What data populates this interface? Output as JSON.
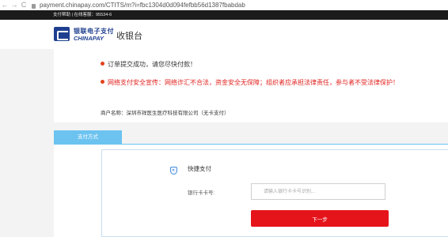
{
  "browser": {
    "url": "payment.chinapay.com/CTITS/m?i=fbc1304d0d094fefbb56d1387fbabdab",
    "back_icon": "←",
    "forward_icon": "→",
    "reload_icon": "C"
  },
  "topbar": {
    "text": "支付帮助 | 在线客服：95534-6"
  },
  "header": {
    "logo_cn": "银联电子支付",
    "logo_en": "CHINAPAY",
    "title": "收银台"
  },
  "order": {
    "notice_success": "订单提交成功，请您尽快付款！",
    "notice_warning": "网络支付安全宣传：网络诈汇不合法，资金安全无保障；组织者应承担法律责任，参与者不受法律保护！",
    "merchant": "商户名称：深圳市祥医生医疗科技有限公司（无卡支付）"
  },
  "tabs": {
    "payment_method": "支付方式"
  },
  "payment": {
    "quick_pay_label": "快捷支付",
    "card_label": "银行卡卡号:",
    "card_placeholder": "请输入银行卡卡号识别...",
    "next_button": "下一步"
  },
  "colors": {
    "brand_blue": "#1e3f8f",
    "tab_blue": "#6cc3f0",
    "button_red": "#e5141b",
    "warning_red": "#e0211d"
  }
}
